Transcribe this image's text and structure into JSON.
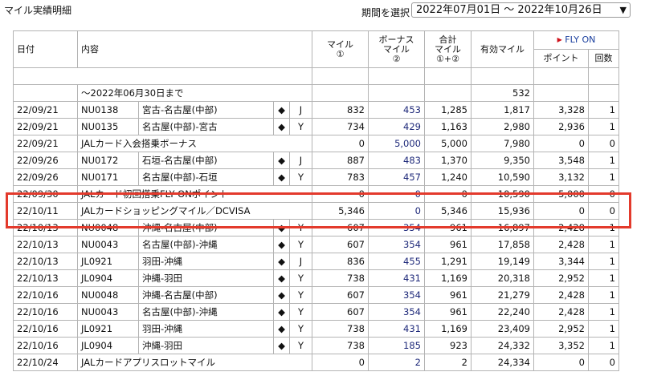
{
  "page_title": "マイル実績明細",
  "period": {
    "label": "期間を選択",
    "value": "2022年07月01日 ～ 2022年10月26日"
  },
  "headers": {
    "date": "日付",
    "content": "内容",
    "mile_l1": "マイル",
    "mile_mark": "①",
    "bonus_l1": "ボーナス",
    "bonus_l2": "マイル",
    "bonus_mark": "②",
    "total_l1": "合計",
    "total_l2": "マイル",
    "total_mark": "①+②",
    "valid": "有効マイル",
    "flyon": "FLY ON",
    "point": "ポイント",
    "count": "回数"
  },
  "carryover": {
    "label": "～2022年06月30日まで",
    "valid": "532"
  },
  "rows": [
    {
      "date": "22/09/21",
      "code": "NU0138",
      "route": "宮古-名古屋(中部)",
      "mark": "◆",
      "cls": "J",
      "mile": "832",
      "bonus": "453",
      "total": "1,285",
      "valid": "1,817",
      "point": "3,328",
      "count": "1"
    },
    {
      "date": "22/09/21",
      "code": "NU0135",
      "route": "名古屋(中部)-宮古",
      "mark": "◆",
      "cls": "Y",
      "mile": "734",
      "bonus": "429",
      "total": "1,163",
      "valid": "2,980",
      "point": "2,936",
      "count": "1"
    },
    {
      "date": "22/09/21",
      "desc": "JALカード入会搭乗ボーナス",
      "mile": "0",
      "bonus": "5,000",
      "total": "5,000",
      "valid": "7,980",
      "point": "0",
      "count": "0"
    },
    {
      "date": "22/09/26",
      "code": "NU0172",
      "route": "石垣-名古屋(中部)",
      "mark": "◆",
      "cls": "J",
      "mile": "887",
      "bonus": "483",
      "total": "1,370",
      "valid": "9,350",
      "point": "3,548",
      "count": "1"
    },
    {
      "date": "22/09/26",
      "code": "NU0171",
      "route": "名古屋(中部)-石垣",
      "mark": "◆",
      "cls": "Y",
      "mile": "783",
      "bonus": "457",
      "total": "1,240",
      "valid": "10,590",
      "point": "3,132",
      "count": "1"
    },
    {
      "date": "22/09/30",
      "desc": "JALカード初回搭乗FLY ONポイント",
      "mile": "0",
      "bonus": "0",
      "total": "0",
      "valid": "10,590",
      "point": "5,000",
      "count": "0"
    },
    {
      "date": "22/10/11",
      "desc": "JALカードショッピングマイル／DCVISA",
      "mile": "5,346",
      "bonus": "0",
      "total": "5,346",
      "valid": "15,936",
      "point": "0",
      "count": "0"
    },
    {
      "date": "22/10/13",
      "code": "NU0048",
      "route": "沖縄-名古屋(中部)",
      "mark": "◆",
      "cls": "Y",
      "mile": "607",
      "bonus": "354",
      "total": "961",
      "valid": "16,897",
      "point": "2,428",
      "count": "1"
    },
    {
      "date": "22/10/13",
      "code": "NU0043",
      "route": "名古屋(中部)-沖縄",
      "mark": "◆",
      "cls": "Y",
      "mile": "607",
      "bonus": "354",
      "total": "961",
      "valid": "17,858",
      "point": "2,428",
      "count": "1"
    },
    {
      "date": "22/10/13",
      "code": "JL0921",
      "route": "羽田-沖縄",
      "mark": "◆",
      "cls": "J",
      "mile": "836",
      "bonus": "455",
      "total": "1,291",
      "valid": "19,149",
      "point": "3,344",
      "count": "1"
    },
    {
      "date": "22/10/13",
      "code": "JL0904",
      "route": "沖縄-羽田",
      "mark": "◆",
      "cls": "Y",
      "mile": "738",
      "bonus": "431",
      "total": "1,169",
      "valid": "20,318",
      "point": "2,952",
      "count": "1"
    },
    {
      "date": "22/10/16",
      "code": "NU0048",
      "route": "沖縄-名古屋(中部)",
      "mark": "◆",
      "cls": "Y",
      "mile": "607",
      "bonus": "354",
      "total": "961",
      "valid": "21,279",
      "point": "2,428",
      "count": "1"
    },
    {
      "date": "22/10/16",
      "code": "NU0043",
      "route": "名古屋(中部)-沖縄",
      "mark": "◆",
      "cls": "Y",
      "mile": "607",
      "bonus": "354",
      "total": "961",
      "valid": "22,240",
      "point": "2,428",
      "count": "1"
    },
    {
      "date": "22/10/16",
      "code": "JL0921",
      "route": "羽田-沖縄",
      "mark": "◆",
      "cls": "Y",
      "mile": "738",
      "bonus": "431",
      "total": "1,169",
      "valid": "23,409",
      "point": "2,952",
      "count": "1"
    },
    {
      "date": "22/10/16",
      "code": "JL0904",
      "route": "沖縄-羽田",
      "mark": "◆",
      "cls": "Y",
      "mile": "738",
      "bonus": "185",
      "total": "923",
      "valid": "24,332",
      "point": "3,352",
      "count": "1"
    },
    {
      "date": "22/10/24",
      "desc": "JALカードアプリスロットマイル",
      "mile": "0",
      "bonus": "2",
      "total": "2",
      "valid": "24,334",
      "point": "0",
      "count": "0"
    }
  ],
  "colors": {
    "highlight": "#e33a2c",
    "flyon": "#1a3f9e",
    "bonus": "#1f2a7a",
    "border": "#b4b4b4"
  }
}
